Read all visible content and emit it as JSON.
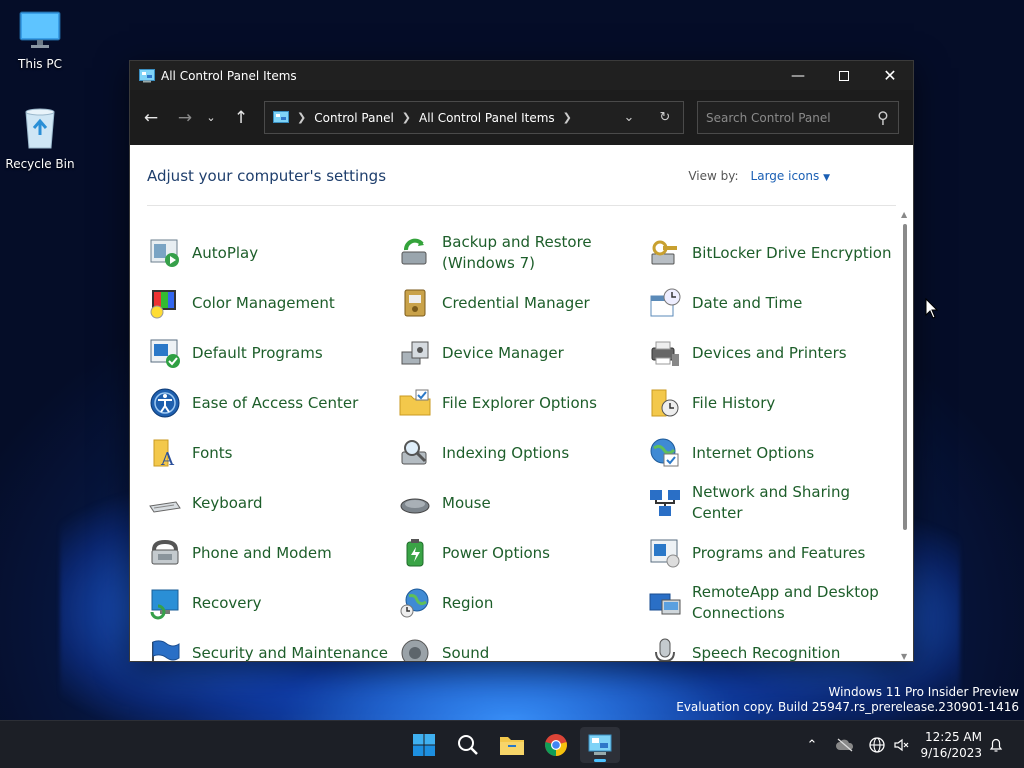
{
  "desktop": {
    "icons": [
      {
        "label": "This PC"
      },
      {
        "label": "Recycle Bin"
      }
    ],
    "watermark": {
      "line1": "Windows 11 Pro Insider Preview",
      "line2": "Evaluation copy. Build 25947.rs_prerelease.230901-1416"
    }
  },
  "window": {
    "title": "All Control Panel Items",
    "breadcrumb": [
      "Control Panel",
      "All Control Panel Items"
    ],
    "search_placeholder": "Search Control Panel",
    "heading": "Adjust your computer's settings",
    "view_by_label": "View by:",
    "view_by_value": "Large icons",
    "items": [
      {
        "label": "AutoPlay",
        "icon": "autoplay-icon"
      },
      {
        "label": "Backup and Restore (Windows 7)",
        "icon": "backup-restore-icon"
      },
      {
        "label": "BitLocker Drive Encryption",
        "icon": "bitlocker-icon"
      },
      {
        "label": "Color Management",
        "icon": "color-management-icon"
      },
      {
        "label": "Credential Manager",
        "icon": "credential-manager-icon"
      },
      {
        "label": "Date and Time",
        "icon": "date-time-icon"
      },
      {
        "label": "Default Programs",
        "icon": "default-programs-icon"
      },
      {
        "label": "Device Manager",
        "icon": "device-manager-icon"
      },
      {
        "label": "Devices and Printers",
        "icon": "devices-printers-icon"
      },
      {
        "label": "Ease of Access Center",
        "icon": "ease-of-access-icon"
      },
      {
        "label": "File Explorer Options",
        "icon": "file-explorer-options-icon"
      },
      {
        "label": "File History",
        "icon": "file-history-icon"
      },
      {
        "label": "Fonts",
        "icon": "fonts-icon"
      },
      {
        "label": "Indexing Options",
        "icon": "indexing-options-icon"
      },
      {
        "label": "Internet Options",
        "icon": "internet-options-icon"
      },
      {
        "label": "Keyboard",
        "icon": "keyboard-icon"
      },
      {
        "label": "Mouse",
        "icon": "mouse-icon"
      },
      {
        "label": "Network and Sharing Center",
        "icon": "network-sharing-icon"
      },
      {
        "label": "Phone and Modem",
        "icon": "phone-modem-icon"
      },
      {
        "label": "Power Options",
        "icon": "power-options-icon"
      },
      {
        "label": "Programs and Features",
        "icon": "programs-features-icon"
      },
      {
        "label": "Recovery",
        "icon": "recovery-icon"
      },
      {
        "label": "Region",
        "icon": "region-icon"
      },
      {
        "label": "RemoteApp and Desktop Connections",
        "icon": "remoteapp-icon"
      },
      {
        "label": "Security and Maintenance",
        "icon": "security-maintenance-icon"
      },
      {
        "label": "Sound",
        "icon": "sound-icon"
      },
      {
        "label": "Speech Recognition",
        "icon": "speech-recognition-icon"
      }
    ]
  },
  "taskbar": {
    "time": "12:25 AM",
    "date": "9/16/2023"
  },
  "colors": {
    "link_green": "#1d5e2a",
    "heading_blue": "#1f3f6d",
    "accent": "#4cc2ff"
  }
}
